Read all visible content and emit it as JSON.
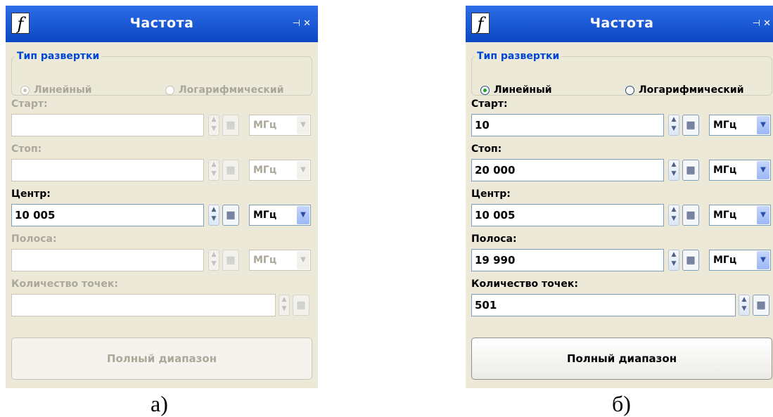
{
  "panels": [
    {
      "id": "a",
      "window_title": "Частота",
      "title_buttons": "⊣ ✕",
      "sweep_type": {
        "legend": "Тип развертки",
        "options": [
          "Линейный",
          "Логарифмический"
        ],
        "selected": "Линейный",
        "enabled": false
      },
      "fields": [
        {
          "label": "Старт:",
          "value": "",
          "unit": "МГц",
          "enabled": false
        },
        {
          "label": "Стоп:",
          "value": "",
          "unit": "МГц",
          "enabled": false
        },
        {
          "label": "Центр:",
          "value": "10 005",
          "unit": "МГц",
          "enabled": true
        },
        {
          "label": "Полоса:",
          "value": "",
          "unit": "МГц",
          "enabled": false
        },
        {
          "label": "Количество точек:",
          "value": "",
          "unit": "",
          "enabled": false
        }
      ],
      "full_range_button": "Полный диапазон",
      "full_range_enabled": false,
      "caption": "а)"
    },
    {
      "id": "b",
      "window_title": "Частота",
      "title_buttons": "⊣ ✕",
      "sweep_type": {
        "legend": "Тип развертки",
        "options": [
          "Линейный",
          "Логарифмический"
        ],
        "selected": "Линейный",
        "enabled": true
      },
      "fields": [
        {
          "label": "Старт:",
          "value": "10",
          "unit": "МГц",
          "enabled": true
        },
        {
          "label": "Стоп:",
          "value": "20 000",
          "unit": "МГц",
          "enabled": true
        },
        {
          "label": "Центр:",
          "value": "10 005",
          "unit": "МГц",
          "enabled": true
        },
        {
          "label": "Полоса:",
          "value": "19 990",
          "unit": "МГц",
          "enabled": true
        },
        {
          "label": "Количество точек:",
          "value": "501",
          "unit": "",
          "enabled": true
        }
      ],
      "full_range_button": "Полный диапазон",
      "full_range_enabled": true,
      "caption": "б)"
    }
  ]
}
